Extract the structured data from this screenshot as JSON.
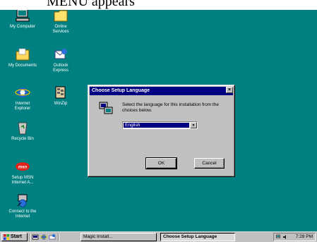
{
  "caption": "MENU appears",
  "desktop_icons": [
    {
      "label": "My Computer"
    },
    {
      "label": "Online\nServices"
    },
    {
      "label": "My Documents"
    },
    {
      "label": "Outlook\nExpress"
    },
    {
      "label": "Internet\nExplorer"
    },
    {
      "label": "WinZip"
    },
    {
      "label": "Recycle Bin"
    },
    {
      "label": "Setup MSN\nInternet A..."
    },
    {
      "label": "Connect to the\nInternet"
    }
  ],
  "dialog": {
    "title": "Choose Setup Language",
    "close": "×",
    "message": "Select the language for this installation from the choices below.",
    "language_selected": "English",
    "dropdown_arrow": "▼",
    "ok_label": "OK",
    "cancel_label": "Cancel"
  },
  "taskbar": {
    "start_label": "Start",
    "tasks": [
      {
        "label": "Magic Install..."
      },
      {
        "label": "Choose Setup Language"
      }
    ],
    "clock": "7:28 PM"
  },
  "colors": {
    "desktop": "#008080",
    "title_bar": "#000080",
    "face": "#c0c0c0"
  }
}
